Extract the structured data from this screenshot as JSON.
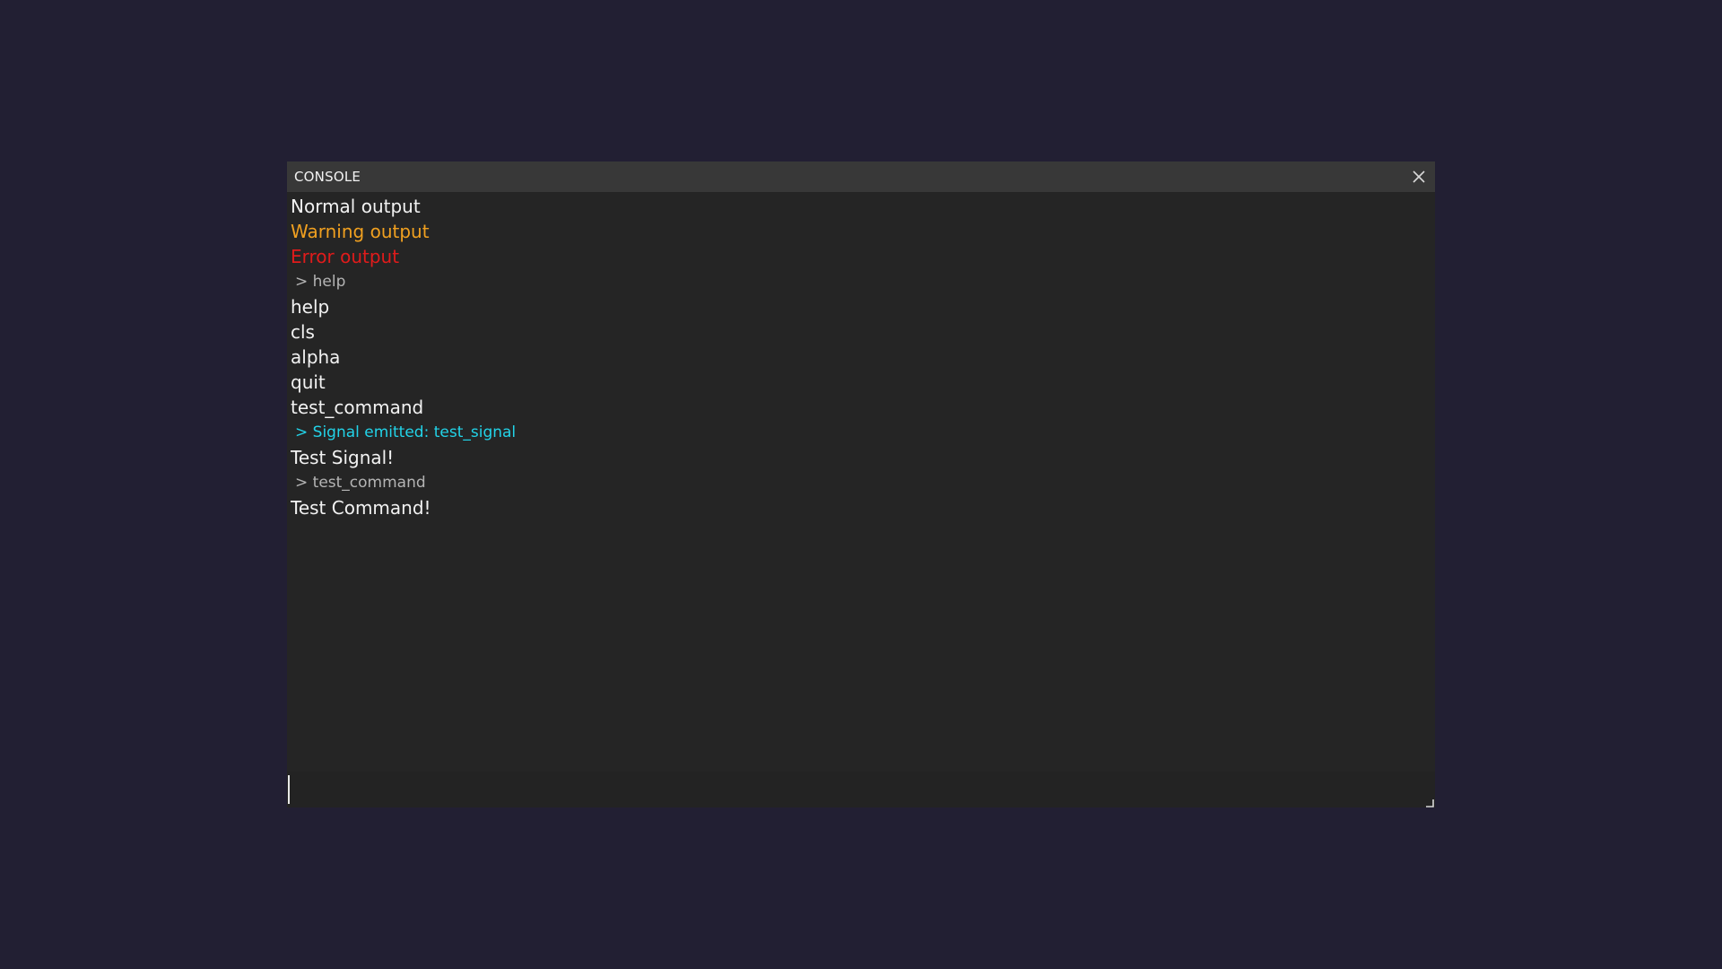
{
  "window": {
    "title": "CONSOLE",
    "close_icon": "close-icon",
    "resize_icon": "resize-grip-icon"
  },
  "colors": {
    "background": "#221f33",
    "panel": "#252525",
    "title_bar": "#383838",
    "normal": "#f2f2f2",
    "warning": "#f0a020",
    "error": "#e01b1b",
    "echo": "#b4b4b4",
    "signal": "#22d3e8"
  },
  "log": {
    "lines": [
      {
        "text": "Normal output",
        "kind": "normal"
      },
      {
        "text": "Warning output",
        "kind": "warning"
      },
      {
        "text": "Error output",
        "kind": "error"
      },
      {
        "text": "> help",
        "kind": "echo"
      },
      {
        "text": "help",
        "kind": "normal"
      },
      {
        "text": "cls",
        "kind": "normal"
      },
      {
        "text": "alpha",
        "kind": "normal"
      },
      {
        "text": "quit",
        "kind": "normal"
      },
      {
        "text": "test_command",
        "kind": "normal"
      },
      {
        "text": "> Signal emitted: test_signal",
        "kind": "signal"
      },
      {
        "text": "Test Signal!",
        "kind": "normal"
      },
      {
        "text": "> test_command",
        "kind": "echo"
      },
      {
        "text": "Test Command!",
        "kind": "normal"
      }
    ]
  },
  "input": {
    "value": "",
    "placeholder": ""
  }
}
